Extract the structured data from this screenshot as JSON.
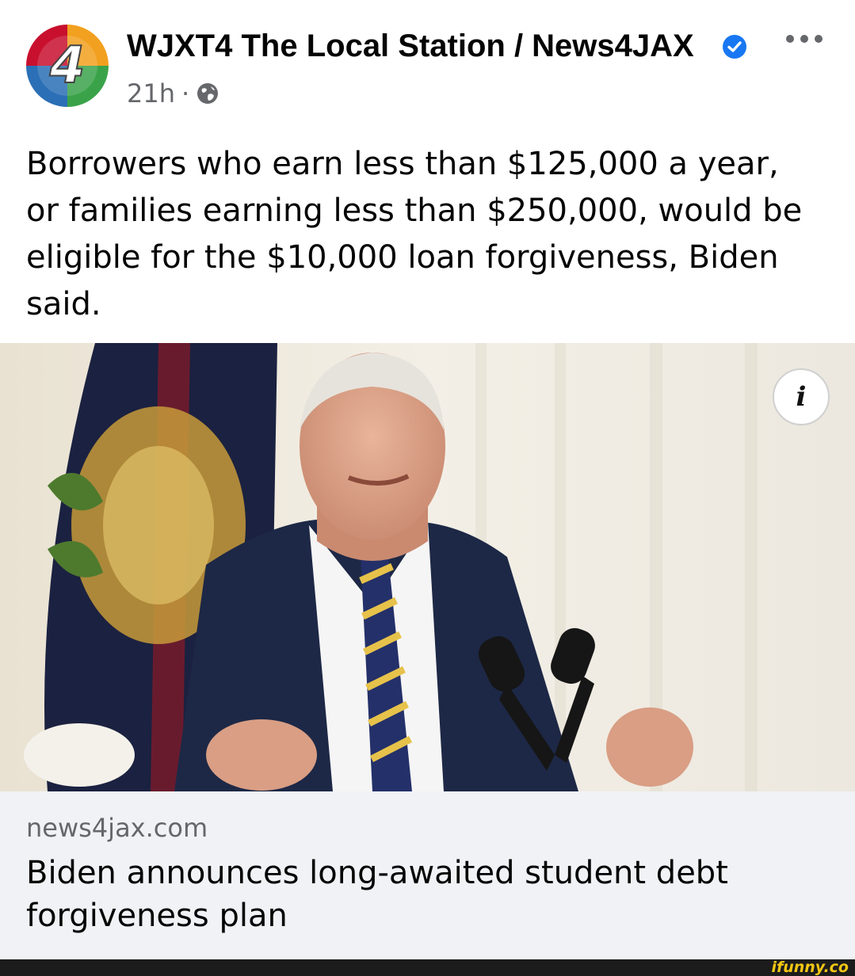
{
  "header": {
    "page_name": "WJXT4 The Local Station / News4JAX",
    "avatar_text": "4",
    "verified_icon": "verified-badge-icon",
    "more_icon": "more-options-icon",
    "time": "21h",
    "separator": "·",
    "audience_icon": "globe-icon"
  },
  "post": {
    "text": "Borrowers who earn less than $125,000 a year, or families earning less than $250,000, would be eligible for the $10,000 loan forgiveness, Biden said."
  },
  "photo": {
    "info_label": "i"
  },
  "link_preview": {
    "domain": "news4jax.com",
    "title": "Biden announces long-awaited student debt forgiveness plan"
  },
  "footer": {
    "watermark": "ifunny.co"
  },
  "colors": {
    "verified": "#1877f2",
    "secondary_text": "#65676b",
    "card_bg": "#f0f2f5",
    "watermark": "#f3c614"
  }
}
